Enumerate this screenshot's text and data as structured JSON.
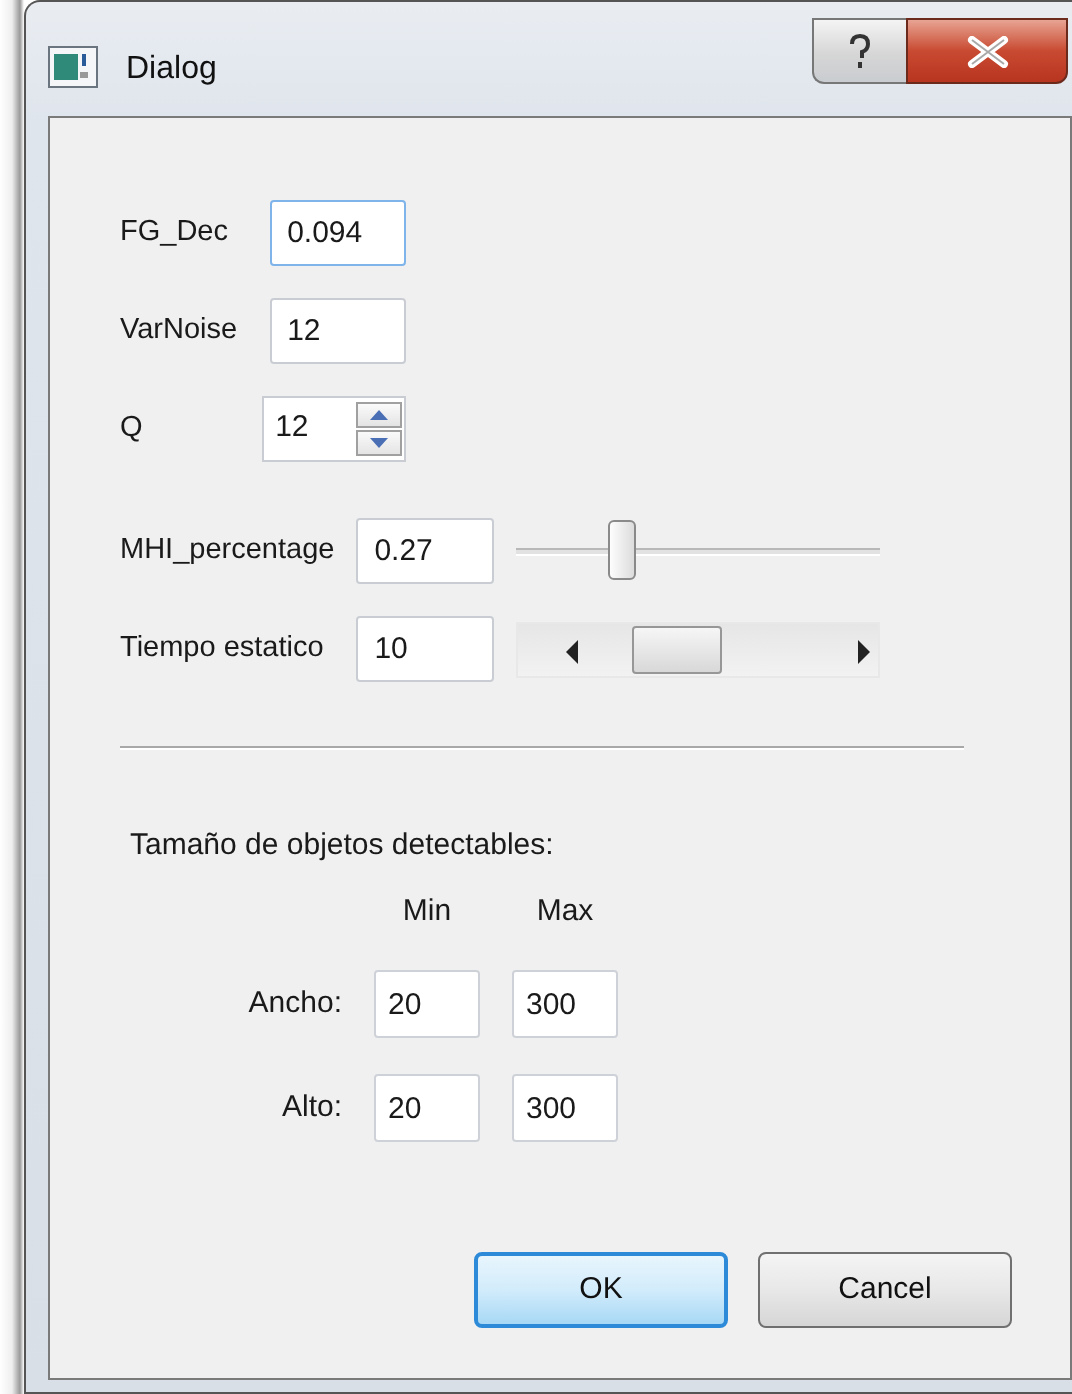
{
  "window": {
    "title": "Dialog"
  },
  "fields": [
    {
      "label": "FG_Dec",
      "value": "0.094",
      "kind": "text",
      "focused": true
    },
    {
      "label": "VarNoise",
      "value": "12",
      "kind": "text",
      "focused": false
    },
    {
      "label": "Q",
      "value": "12",
      "kind": "spin",
      "focused": false
    },
    {
      "label": "MHI_percentage",
      "value": "0.27",
      "kind": "slider",
      "focused": false,
      "level": 0.29
    },
    {
      "label": "Tiempo estatico",
      "value": "10",
      "kind": "scrollbar",
      "focused": false
    }
  ],
  "size_group": {
    "title": "Tamaño de objetos detectables:",
    "columns": [
      "Min",
      "Max"
    ],
    "rows": [
      {
        "label": "Ancho:",
        "min": "20",
        "max": "300"
      },
      {
        "label": "Alto:",
        "min": "20",
        "max": "300"
      }
    ]
  },
  "buttons": [
    {
      "label": "OK",
      "default": true
    },
    {
      "label": "Cancel",
      "default": false
    }
  ]
}
